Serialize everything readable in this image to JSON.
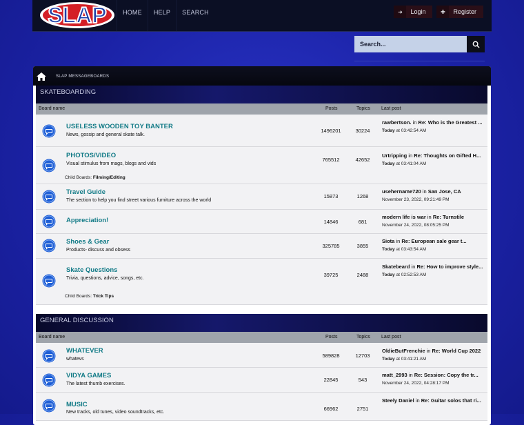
{
  "header": {
    "logo_text": "SLAP",
    "nav": [
      "HOME",
      "HELP",
      "SEARCH"
    ],
    "login_label": "Login",
    "register_label": "Register"
  },
  "search": {
    "placeholder": "Search..."
  },
  "breadcrumb": "SLAP MESSAGEBOARDS",
  "columns": {
    "board": "Board name",
    "posts": "Posts",
    "topics": "Topics",
    "last": "Last post"
  },
  "categories": [
    {
      "name": "SKATEBOARDING",
      "boards": [
        {
          "title": "USELESS WOODEN TOY BANTER",
          "desc": "News, gossip and general skate talk.",
          "posts": "1496201",
          "topics": "30224",
          "lp_user": "rawbertson.",
          "lp_in": "in",
          "lp_topic": "Re: Who is the Greatest ...",
          "lp_time_prefix": "Today",
          "lp_time": "at 03:42:54 AM"
        },
        {
          "title": "PHOTOS/VIDEO",
          "desc": "Visual stimulus from mags, blogs and vids",
          "posts": "765512",
          "topics": "42652",
          "lp_user": "Urtripping",
          "lp_in": "in",
          "lp_topic": "Re: Thoughts on Gifted H...",
          "lp_time_prefix": "Today",
          "lp_time": "at 03:41:04 AM",
          "child_label": "Child Boards:",
          "child": "Filming/Editing"
        },
        {
          "title": "Travel Guide",
          "desc": "The section to help you find street various furniture across the world",
          "posts": "15873",
          "topics": "1268",
          "lp_user": "usehername720",
          "lp_in": "in",
          "lp_topic": "San Jose, CA",
          "lp_time": "November 23, 2022, 09:21:49 PM"
        },
        {
          "title": "Appreciation!",
          "desc": "",
          "posts": "14846",
          "topics": "681",
          "lp_user": "modern life is war",
          "lp_in": "in",
          "lp_topic": "Re: Turnstile",
          "lp_time": "November 24, 2022, 08:05:25 PM"
        },
        {
          "title": "Shoes & Gear",
          "desc": "Products- discuss and obsess",
          "posts": "325785",
          "topics": "3855",
          "lp_user": "Siota",
          "lp_in": "in",
          "lp_topic": "Re: European sale gear t...",
          "lp_time_prefix": "Today",
          "lp_time": "at 03:43:54 AM"
        },
        {
          "title": "Skate Questions",
          "desc": "Trivia, questions, advice, songs, etc.",
          "posts": "39725",
          "topics": "2488",
          "lp_user": "Skatebeard",
          "lp_in": "in",
          "lp_topic": "Re: How to improve style...",
          "lp_time_prefix": "Today",
          "lp_time": "at 02:52:53 AM",
          "child_label": "Child Boards:",
          "child": "Trick Tips"
        }
      ]
    },
    {
      "name": "GENERAL DISCUSSION",
      "boards": [
        {
          "title": "WHATEVER",
          "desc": "whatevs",
          "posts": "589828",
          "topics": "12703",
          "lp_user": "OldieButFrenchie",
          "lp_in": "in",
          "lp_topic": "Re: World Cup 2022",
          "lp_time_prefix": "Today",
          "lp_time": "at 03:41:21 AM"
        },
        {
          "title": "VIDYA GAMES",
          "desc": "The latest thumb exercises.",
          "posts": "22845",
          "topics": "543",
          "lp_user": "matt_2993",
          "lp_in": "in",
          "lp_topic": "Re: Session: Copy the tr...",
          "lp_time": "November 24, 2022, 04:28:17 PM"
        },
        {
          "title": "MUSIC",
          "desc": "New tracks, old tunes, video soundtracks, etc.",
          "posts": "66962",
          "topics": "2751",
          "lp_user": "Steely Daniel",
          "lp_in": "in",
          "lp_topic": "Re: Guitar solos that ri..."
        }
      ]
    }
  ],
  "colors": {
    "title": "#117a86",
    "icon": "#1f5fd6"
  }
}
